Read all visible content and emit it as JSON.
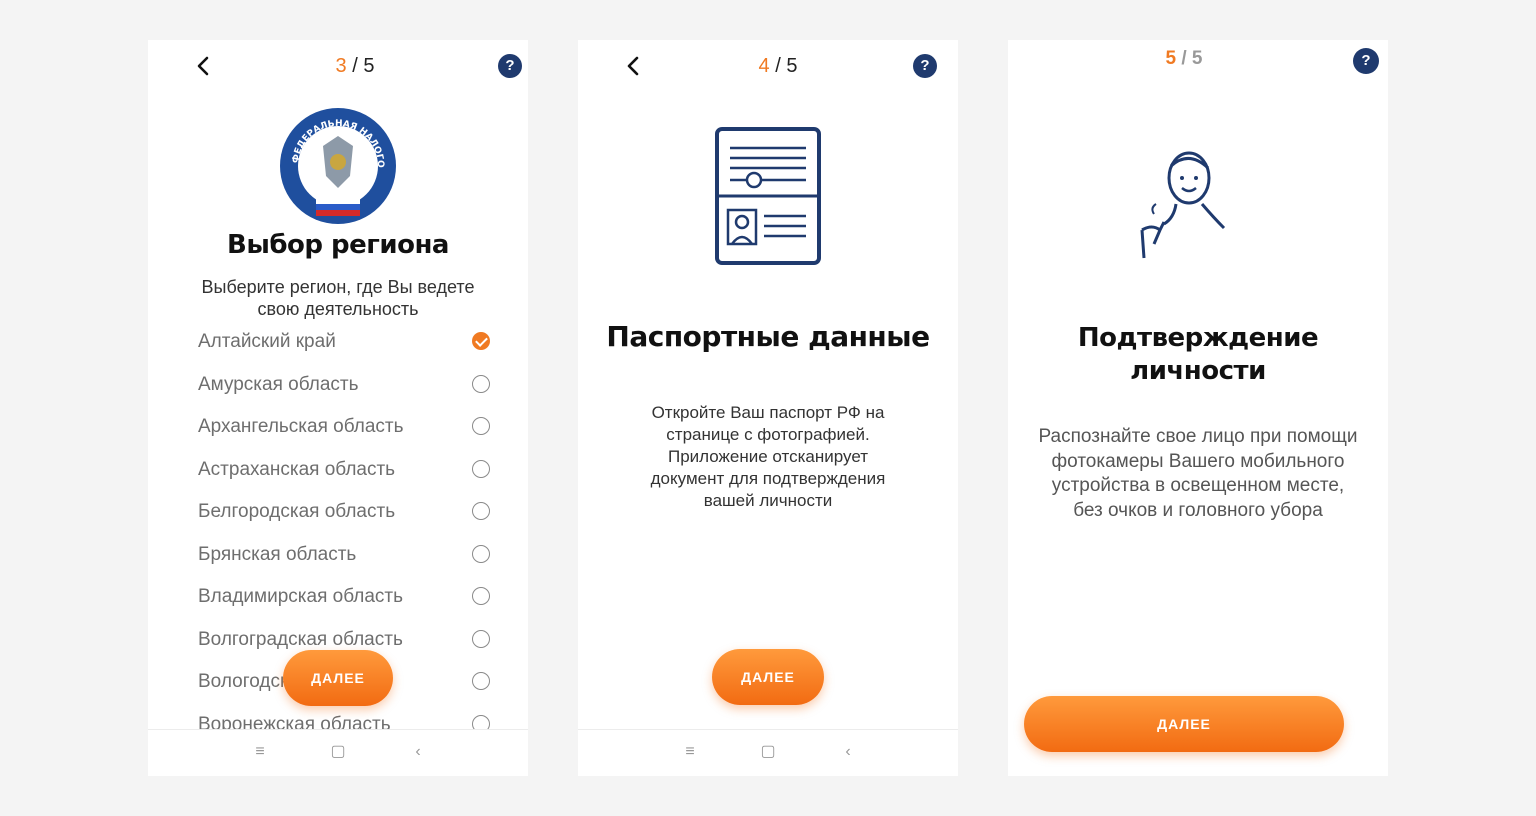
{
  "screen1": {
    "step_current": "3",
    "step_total": "/ 5",
    "help": "?",
    "title": "Выбор региона",
    "description": "Выберите регион, где Вы ведете свою деятельность",
    "logo_text": "ФЕДЕРАЛЬНАЯ НАЛОГОВАЯ СЛУЖБА",
    "regions": [
      {
        "label": "Алтайский край",
        "selected": true
      },
      {
        "label": "Амурская область",
        "selected": false
      },
      {
        "label": "Архангельская область",
        "selected": false
      },
      {
        "label": "Астраханская область",
        "selected": false
      },
      {
        "label": "Белгородская область",
        "selected": false
      },
      {
        "label": "Брянская область",
        "selected": false
      },
      {
        "label": "Владимирская область",
        "selected": false
      },
      {
        "label": "Волгоградская область",
        "selected": false
      },
      {
        "label": "Вологодская область",
        "selected": false
      },
      {
        "label": "Воронежская область",
        "selected": false
      }
    ],
    "button": "ДАЛЕЕ"
  },
  "screen2": {
    "step_current": "4",
    "step_total": "/ 5",
    "help": "?",
    "title": "Паспортные данные",
    "description": "Откройте Ваш паспорт РФ на странице с фотографией. Приложение отсканирует документ для подтверждения вашей личности",
    "button": "ДАЛЕЕ"
  },
  "screen3": {
    "step_current": "5",
    "step_total": "/ 5",
    "help": "?",
    "title": "Подтверждение личности",
    "description": "Распознайте свое лицо при помощи фотокамеры Вашего мобильного устройства в освещенном месте, без очков и головного убора",
    "button": "ДАЛЕЕ"
  },
  "colors": {
    "accent": "#f07a22",
    "help_bg": "#1f3a6e",
    "icon_stroke": "#1f3a6e"
  },
  "icons": [
    "chevron-left-icon",
    "help-icon",
    "passport-icon",
    "face-id-icon",
    "menu-icon",
    "square-icon",
    "back-triangle-icon",
    "checkmark-icon"
  ]
}
